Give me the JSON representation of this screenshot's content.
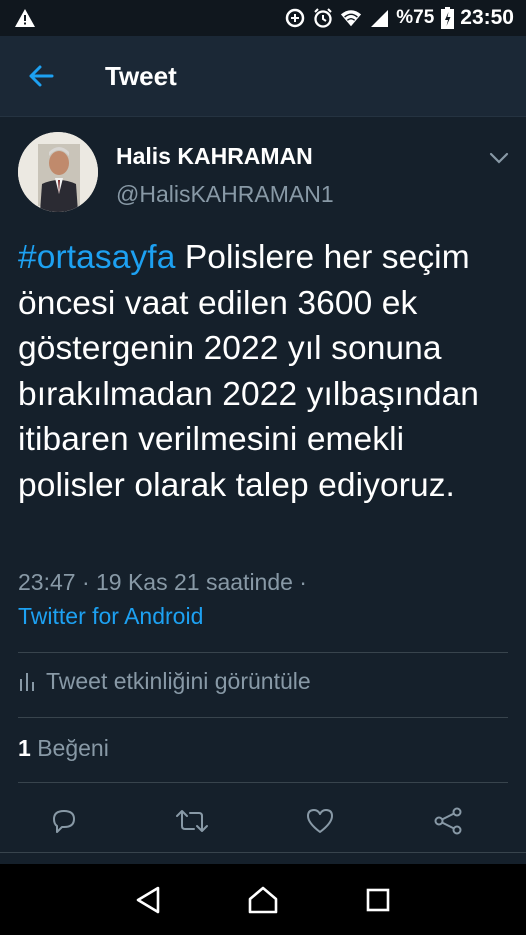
{
  "status_bar": {
    "battery_text": "%75",
    "time": "23:50",
    "icons": [
      "warning-icon",
      "data-saver-icon",
      "alarm-icon",
      "wifi-icon",
      "signal-icon",
      "battery-icon"
    ]
  },
  "app_bar": {
    "title": "Tweet",
    "back_icon": "arrow-left-icon"
  },
  "tweet": {
    "author_name": "Halis KAHRAMAN",
    "author_handle": "@HalisKAHRAMAN1",
    "hashtag": "#ortasayfa",
    "body": " Polislere her seçim öncesi vaat edilen 3600 ek göstergenin 2022 yıl sonuna bırakılmadan 2022 yılbaşından itibaren verilmesini emekli polisler olarak talep ediyoruz.",
    "timestamp": "23:47 · 19 Kas 21 saatinde ·",
    "source": "Twitter for Android",
    "activity_label": "Tweet etkinliğini görüntüle",
    "like_count": "1",
    "like_label": "Beğeni"
  },
  "actions": [
    "reply-icon",
    "retweet-icon",
    "like-icon",
    "share-icon"
  ],
  "colors": {
    "background": "#15202b",
    "accent": "#1da1f2",
    "secondary_text": "#8899a6",
    "divider": "#38444d"
  },
  "nav_bar": [
    "back-triangle-icon",
    "home-icon",
    "recents-icon"
  ]
}
